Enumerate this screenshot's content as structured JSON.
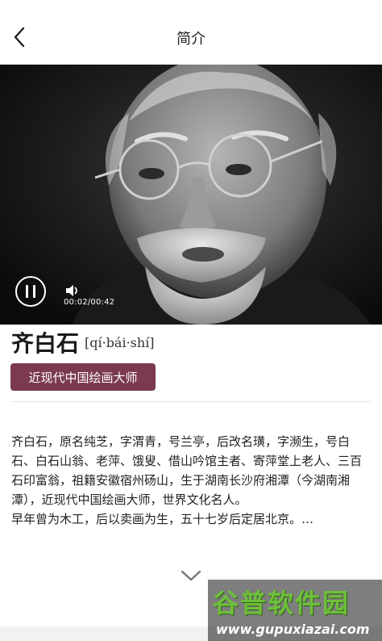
{
  "header": {
    "title": "简介",
    "back_icon": "chevron-left-icon"
  },
  "media": {
    "time": "00:02/00:42",
    "play_state_icon": "pause-icon",
    "volume_icon": "speaker-icon"
  },
  "profile": {
    "name": "齐白石",
    "pinyin": "[qí·bái·shí]",
    "tag": "近现代中国绘画大师",
    "tag_color": "#7b3a4e"
  },
  "bio": {
    "paragraph1": "齐白石，原名纯芝，字渭青，号兰亭，后改名璜，字濒生，号白石、白石山翁、老萍、饿叟、借山吟馆主者、寄萍堂上老人、三百石印富翁，祖籍安徽宿州砀山，生于湖南长沙府湘潭（今湖南湘潭），近现代中国绘画大师，世界文化名人。",
    "paragraph2": "早年曾为木工，后以卖画为生，五十七岁后定居北京。…",
    "expand_icon": "chevron-down-icon"
  },
  "watermark": {
    "title": "谷普软件园",
    "url": "www.gupuxiazai.com"
  }
}
